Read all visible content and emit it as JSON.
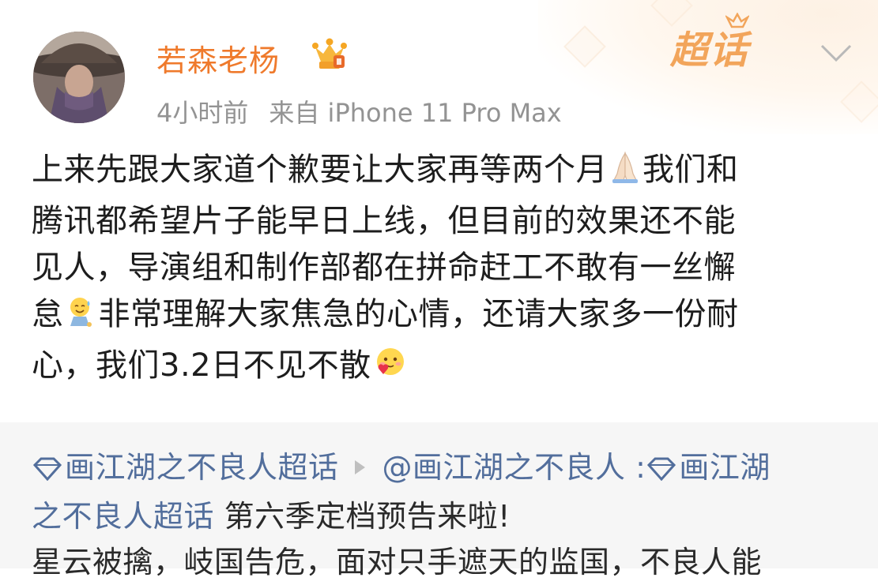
{
  "header": {
    "username": "若森老杨",
    "time": "4小时前",
    "source": "来自 iPhone 11 Pro Max",
    "supertopic_badge": "超话"
  },
  "post": {
    "line1": "上来先跟大家道个歉要让大家再等两个月",
    "line1b": "我们和",
    "line2": "腾讯都希望片子能早日上线，但目前的效果还不能",
    "line3": "见人，导演组和制作部都在拼命赶工不敢有一丝懈",
    "line4a": "怠",
    "line4b": "非常理解大家焦急的心情，还请大家多一份耐",
    "line5": "心，我们3.2日不见不散"
  },
  "repost": {
    "topic_link": "画江湖之不良人超话",
    "author_link": "@画江湖之不良人",
    "colon": " :",
    "topic_link2_part1": "画江湖",
    "topic_link2_part2": "之不良人超话",
    "text1": " 第六季定档预告来啦!",
    "text2": "星云被擒，岐国告危，面对只手遮天的监国，不良人能"
  },
  "icons": {
    "crown": "crown-badge-icon",
    "chevron": "chevron-down-icon",
    "pray": "praying-hands-emoji",
    "sweat": "sweat-smile-emoji",
    "love": "heart-face-emoji",
    "supertopic": "supertopic-diamond-icon"
  },
  "colors": {
    "username": "#ef7a2c",
    "link": "#526e9c",
    "meta": "#939393",
    "badge": "#f2a55b",
    "repost_bg": "#f6f6f6"
  }
}
